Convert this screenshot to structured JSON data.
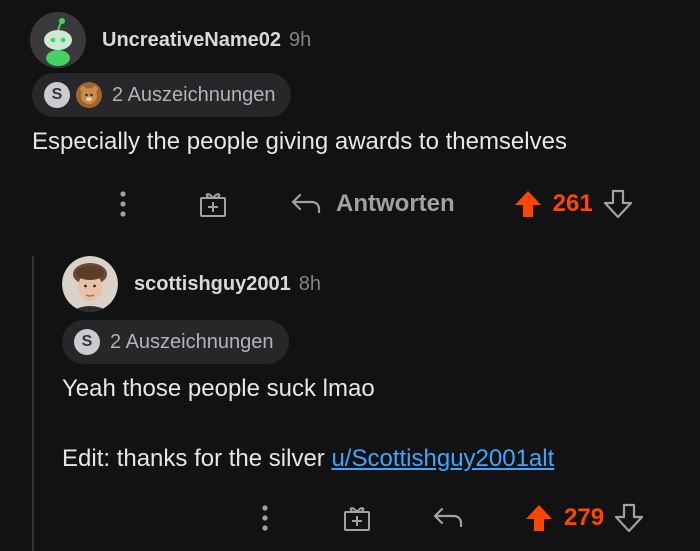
{
  "comments": [
    {
      "username": "UncreativeName02",
      "time": "9h",
      "awards_text": "2 Auszeichnungen",
      "body": "Especially the people giving awards to themselves",
      "reply_label": "Antworten",
      "score": "261",
      "icons": [
        "snoo-avatar-icon",
        "silver-award-icon",
        "bear-award-icon",
        "more-options-icon",
        "gift-icon",
        "reply-icon",
        "upvote-icon",
        "downvote-icon"
      ]
    },
    {
      "username": "scottishguy2001",
      "time": "8h",
      "awards_text": "2 Auszeichnungen",
      "body_line1": "Yeah those people suck lmao",
      "body_line2_prefix": "Edit: thanks for the silver ",
      "body_link": "u/Scottishguy2001alt",
      "score": "279",
      "icons": [
        "user-photo-avatar",
        "silver-award-icon",
        "more-options-icon",
        "gift-icon",
        "reply-icon",
        "upvote-icon",
        "downvote-icon"
      ]
    }
  ],
  "colors": {
    "background": "#121212",
    "upvote": "#ff4500",
    "link": "#3ea6ff",
    "snoo_green": "#46d160"
  }
}
